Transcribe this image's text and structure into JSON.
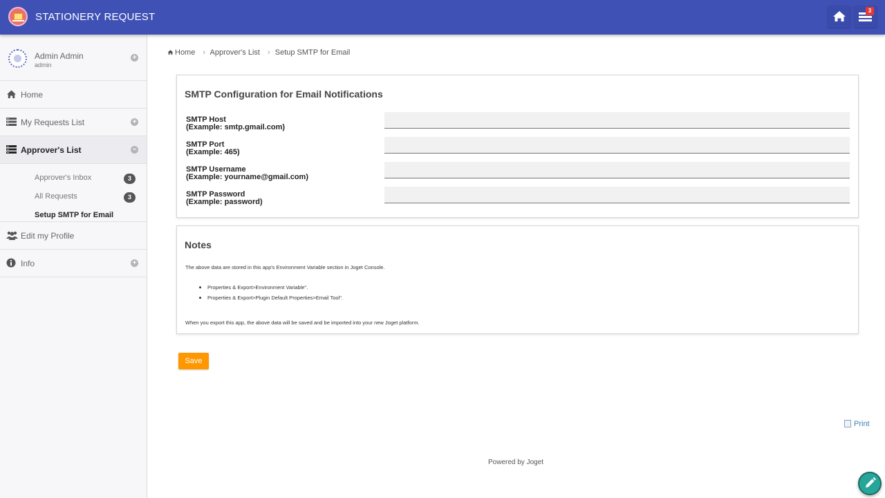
{
  "header": {
    "app_title": "STATIONERY REQUEST",
    "icons": [
      "app-logo-icon",
      "home-icon",
      "list-icon"
    ],
    "notification_count": "3",
    "color": "#3f51b5"
  },
  "sidebar": {
    "user": {
      "name": "Admin Admin",
      "role": "admin"
    },
    "items": [
      {
        "label": "Home",
        "icon": "home-icon"
      },
      {
        "label": "My Requests List",
        "icon": "list-icon"
      },
      {
        "label": "Approver's List",
        "icon": "list-icon",
        "active": true
      },
      {
        "label": "Edit my Profile",
        "icon": "users-icon"
      },
      {
        "label": "Info",
        "icon": "info-icon"
      }
    ],
    "submenu": [
      {
        "label": "Approver's Inbox",
        "count": "3"
      },
      {
        "label": "All Requests",
        "count": "3"
      },
      {
        "label": "Setup SMTP for Email"
      }
    ]
  },
  "breadcrumb": [
    "Home",
    "Approver's List",
    "Setup SMTP for Email"
  ],
  "smtp_form": {
    "title": "SMTP Configuration for Email Notifications",
    "fields": [
      {
        "label": "SMTP Host",
        "hint": "(Example: smtp.gmail.com)",
        "value": ""
      },
      {
        "label": "SMTP Port",
        "hint": "(Example: 465)",
        "value": ""
      },
      {
        "label": "SMTP Username",
        "hint": "(Example: yourname@gmail.com)",
        "value": ""
      },
      {
        "label": "SMTP Password",
        "hint": "(Example: password)",
        "value": ""
      }
    ]
  },
  "notes": {
    "title": "Notes",
    "intro": "The above data are stored in this app's Environment Variable section in Joget Console.",
    "list": [
      "Properties & Export>Environment Variable\".",
      "Properties & Export>Plugin Default Properties>Email Tool\"."
    ],
    "footer": "When you export this app, the above data will be saved and be imported into your new Joget platform."
  },
  "actions": {
    "save_label": "Save",
    "save_color": "#ff9800"
  },
  "footer": {
    "print_label": "Print",
    "powered_by": "Powered by Joget"
  }
}
